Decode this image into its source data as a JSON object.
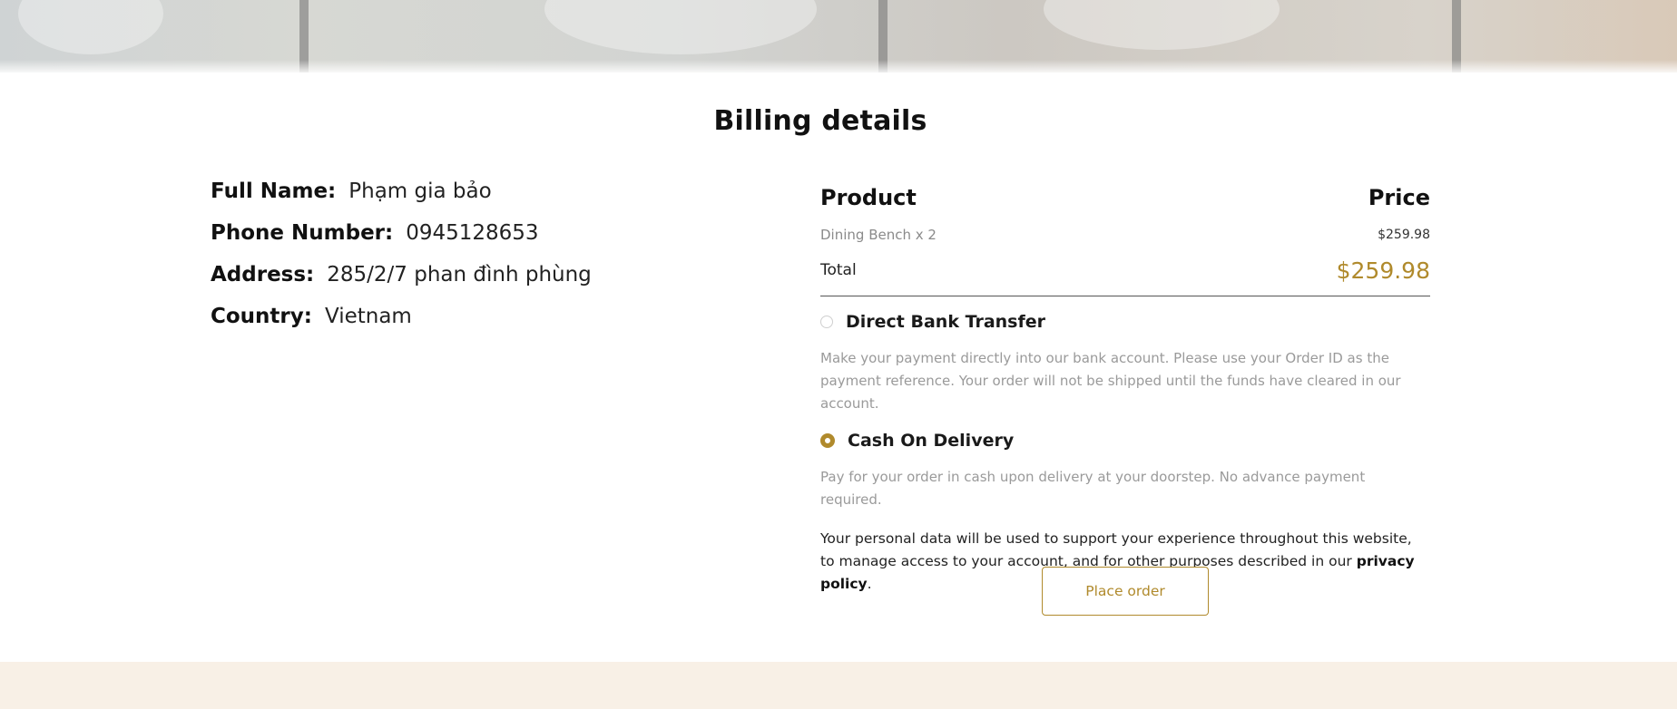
{
  "page": {
    "title": "Billing details"
  },
  "billing": {
    "full_name_label": "Full Name:",
    "full_name_value": "Phạm gia bảo",
    "phone_label": "Phone Number:",
    "phone_value": "0945128653",
    "address_label": "Address:",
    "address_value": "285/2/7 phan đình phùng",
    "country_label": "Country:",
    "country_value": "Vietnam"
  },
  "order": {
    "product_header": "Product",
    "price_header": "Price",
    "items": [
      {
        "name": "Dining Bench x 2",
        "price": "$259.98"
      }
    ],
    "total_label": "Total",
    "total_value": "$259.98"
  },
  "payment": {
    "options": [
      {
        "label": "Direct Bank Transfer",
        "selected": false,
        "description": "Make your payment directly into our bank account. Please use your Order ID as the payment reference. Your order will not be shipped until the funds have cleared in our account."
      },
      {
        "label": "Cash On Delivery",
        "selected": true,
        "description": "Pay for your order in cash upon delivery at your doorstep. No advance payment required."
      }
    ]
  },
  "privacy": {
    "text": "Your personal data will be used to support your experience throughout this website, to manage access to your account, and for other purposes described in our ",
    "link": "privacy policy",
    "suffix": "."
  },
  "actions": {
    "place_order": "Place order"
  },
  "colors": {
    "accent": "#b08a2c",
    "footer_band": "#f8f0e6"
  }
}
